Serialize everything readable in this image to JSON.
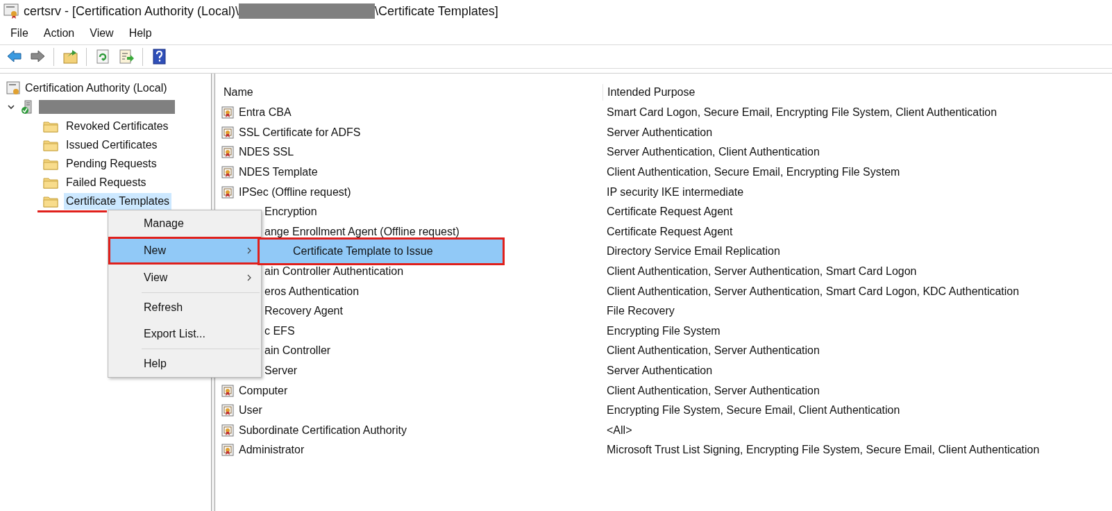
{
  "window": {
    "title_prefix": "certsrv - [Certification Authority (Local)\\",
    "title_suffix": "\\Certificate Templates]"
  },
  "menu_bar": [
    "File",
    "Action",
    "View",
    "Help"
  ],
  "toolbar": [
    {
      "kind": "back",
      "disabled": false
    },
    {
      "kind": "forward",
      "disabled": true
    },
    {
      "kind": "up"
    },
    {
      "kind": "refresh"
    },
    {
      "kind": "export"
    },
    {
      "kind": "help"
    }
  ],
  "tree": {
    "label": "Certification Authority (Local)",
    "children": [
      {
        "expanded": true,
        "children": [
          {
            "label": "Revoked Certificates",
            "selected": false,
            "underlined": false
          },
          {
            "label": "Issued Certificates",
            "selected": false,
            "underlined": false
          },
          {
            "label": "Pending Requests",
            "selected": false,
            "underlined": false
          },
          {
            "label": "Failed Requests",
            "selected": false,
            "underlined": false
          },
          {
            "label": "Certificate Templates",
            "selected": true,
            "underlined": true
          }
        ]
      }
    ]
  },
  "list": {
    "columns": [
      "Name",
      "Intended Purpose"
    ],
    "rows": [
      {
        "name": "Entra CBA",
        "purpose": "Smart Card Logon, Secure Email, Encrypting File System, Client Authentication",
        "covered": false
      },
      {
        "name": "SSL Certificate for ADFS",
        "purpose": "Server Authentication",
        "covered": false
      },
      {
        "name": "NDES SSL",
        "purpose": "Server Authentication, Client Authentication",
        "covered": false
      },
      {
        "name": "NDES Template",
        "purpose": "Client Authentication, Secure Email, Encrypting File System",
        "covered": false
      },
      {
        "name": "IPSec (Offline request)",
        "purpose": "IP security IKE intermediate",
        "covered": false
      },
      {
        "name": "Encryption",
        "purpose": "Certificate Request Agent",
        "covered": true
      },
      {
        "name": "ange Enrollment Agent (Offline request)",
        "purpose": "Certificate Request Agent",
        "covered": true
      },
      {
        "purpose": "Directory Service Email Replication"
      },
      {
        "name": "ain Controller Authentication",
        "purpose": "Client Authentication, Server Authentication, Smart Card Logon",
        "covered": true
      },
      {
        "name": "eros Authentication",
        "purpose": "Client Authentication, Server Authentication, Smart Card Logon, KDC Authentication",
        "covered": true
      },
      {
        "name": "Recovery Agent",
        "purpose": "File Recovery",
        "covered": true
      },
      {
        "name": "c EFS",
        "purpose": "Encrypting File System",
        "covered": true
      },
      {
        "name": "ain Controller",
        "purpose": "Client Authentication, Server Authentication",
        "covered": true
      },
      {
        "name": "Server",
        "purpose": "Server Authentication",
        "covered": true
      },
      {
        "name": "Computer",
        "purpose": "Client Authentication, Server Authentication",
        "covered": false
      },
      {
        "name": "User",
        "purpose": "Encrypting File System, Secure Email, Client Authentication",
        "covered": false
      },
      {
        "name": "Subordinate Certification Authority",
        "purpose": "<All>",
        "covered": false
      },
      {
        "name": "Administrator",
        "purpose": "Microsoft Trust List Signing, Encrypting File System, Secure Email, Client Authentication",
        "covered": false
      }
    ]
  },
  "context_menu": {
    "items": [
      {
        "kind": "item",
        "label": "Manage",
        "selected": false,
        "submenu": false,
        "outlined": false
      },
      {
        "kind": "item",
        "label": "New",
        "selected": true,
        "submenu": true,
        "outlined": true
      },
      {
        "kind": "item",
        "label": "View",
        "selected": false,
        "submenu": true,
        "outlined": false
      },
      {
        "kind": "separator"
      },
      {
        "kind": "item",
        "label": "Refresh",
        "selected": false,
        "submenu": false,
        "outlined": false
      },
      {
        "kind": "item",
        "label": "Export List...",
        "selected": false,
        "submenu": false,
        "outlined": false
      },
      {
        "kind": "separator"
      },
      {
        "kind": "item",
        "label": "Help",
        "selected": false,
        "submenu": false,
        "outlined": false
      }
    ],
    "submenu": [
      {
        "label": "Certificate Template to Issue",
        "selected": true,
        "outlined": true
      }
    ]
  }
}
